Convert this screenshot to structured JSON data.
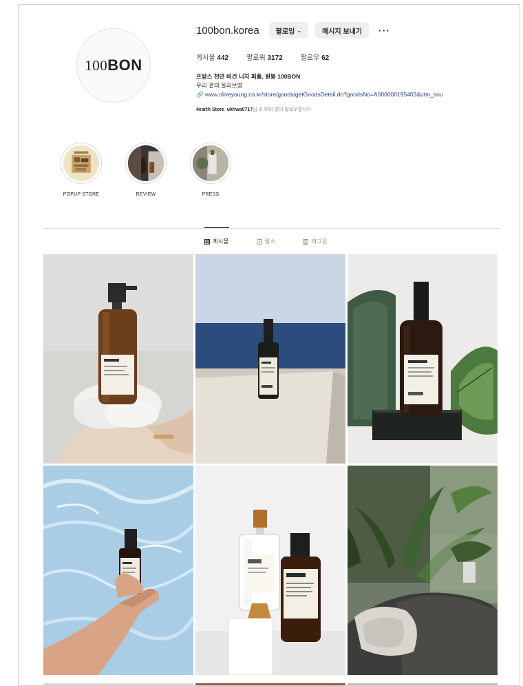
{
  "profile": {
    "username": "100bon.korea",
    "avatar_logo_light": "100",
    "avatar_logo_bold": "BON",
    "follow_button": "팔로잉",
    "message_button": "메시지 보내기",
    "more_icon": "more-horizontal-icon"
  },
  "stats": {
    "posts_label": "게시물",
    "posts_count": "442",
    "followers_label": "팔로워",
    "followers_count": "3172",
    "following_label": "팔로우",
    "following_count": "62"
  },
  "bio": {
    "name": "프랑스 천연 비건 니치 퍼퓸, 원봉 100BON",
    "line2": "우리 곁의 올리브영",
    "link": "www.oliveyoung.co.kr/store/goods/getGoodsDetail.do?goodsNo=A000000195403&utm_sou",
    "followed_by_prefix": "4earth Store",
    "followed_by_user": "ukhwa0717",
    "followed_by_suffix": "님 외 여러 명이 팔로우합니다"
  },
  "highlights": [
    {
      "label": "POPUP STORE"
    },
    {
      "label": "REVIEW"
    },
    {
      "label": "PRESS"
    }
  ],
  "tabs": [
    {
      "label": "게시물",
      "icon": "grid-icon"
    },
    {
      "label": "릴스",
      "icon": "reels-icon"
    },
    {
      "label": "태그됨",
      "icon": "tag-icon"
    }
  ],
  "colors": {
    "link": "#27407e",
    "button_bg": "#efefef",
    "divider": "#dbdbdb"
  }
}
